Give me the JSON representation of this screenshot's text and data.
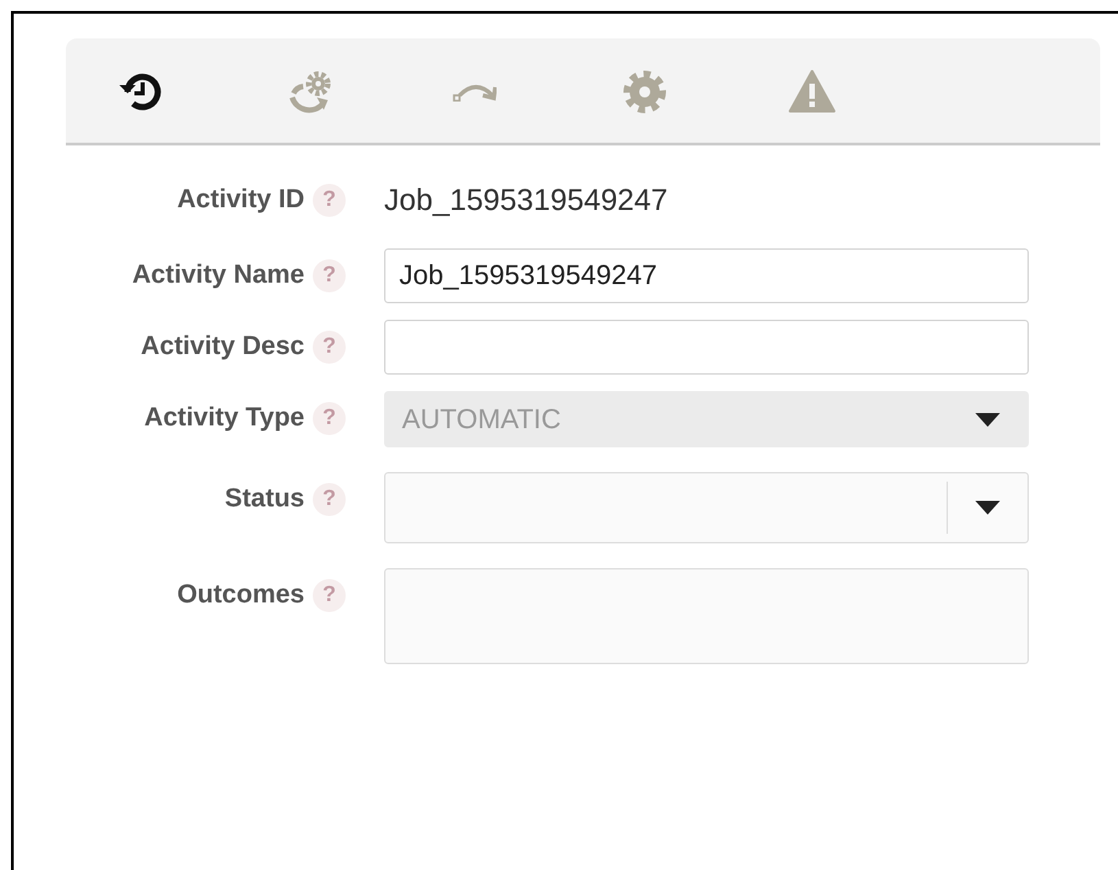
{
  "toolbar": [
    {
      "selected": true
    },
    {
      "selected": false
    },
    {
      "selected": false
    },
    {
      "selected": false
    },
    {
      "selected": false
    }
  ],
  "fields": [
    {
      "label": "Activity ID",
      "help": "?",
      "kind": "text",
      "value": "Job_1595319549247"
    },
    {
      "label": "Activity Name",
      "help": "?",
      "kind": "input",
      "value": "Job_1595319549247"
    },
    {
      "label": "Activity Desc",
      "help": "?",
      "kind": "input"
    },
    {
      "label": "Activity Type",
      "help": "?",
      "kind": "select",
      "value": "AUTOMATIC",
      "disabled": true
    },
    {
      "label": "Status",
      "help": "?",
      "kind": "select",
      "disabled": false
    },
    {
      "label": "Outcomes",
      "help": "?",
      "kind": "textarea"
    }
  ]
}
